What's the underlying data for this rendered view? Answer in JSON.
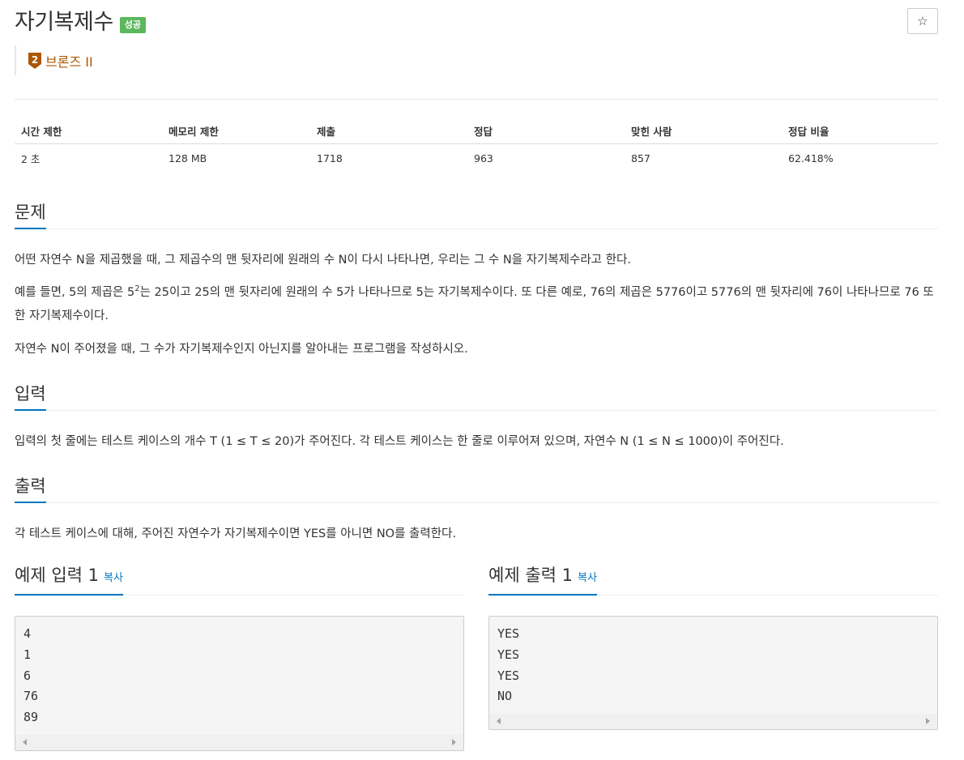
{
  "header": {
    "title": "자기복제수",
    "result_badge": "성공",
    "star_glyph": "☆",
    "tier_number": "2",
    "tier_label": "브론즈 II",
    "tier_color": "#ad5600"
  },
  "info": {
    "columns": [
      "시간 제한",
      "메모리 제한",
      "제출",
      "정답",
      "맞힌 사람",
      "정답 비율"
    ],
    "values": [
      "2 초",
      "128 MB",
      "1718",
      "963",
      "857",
      "62.418%"
    ]
  },
  "problem": {
    "heading": "문제",
    "p1": "어떤 자연수 N을 제곱했을 때, 그 제곱수의 맨 뒷자리에 원래의 수 N이 다시 나타나면, 우리는 그 수 N을 자기복제수라고 한다.",
    "p2_a": "예를 들면, 5의 제곱은 5",
    "p2_sup": "2",
    "p2_b": "는 25이고 25의 맨 뒷자리에 원래의 수 5가 나타나므로 5는 자기복제수이다. 또 다른 예로, 76의 제곱은 5776이고 5776의 맨 뒷자리에 76이 나타나므로 76 또한 자기복제수이다.",
    "p3": "자연수 N이 주어졌을 때, 그 수가 자기복제수인지 아닌지를 알아내는 프로그램을 작성하시오."
  },
  "input": {
    "heading": "입력",
    "text": "입력의 첫 줄에는 테스트 케이스의 개수 T (1 ≤ T ≤ 20)가 주어진다. 각 테스트 케이스는 한 줄로 이루어져 있으며, 자연수 N (1 ≤ N ≤ 1000)이 주어진다."
  },
  "output": {
    "heading": "출력",
    "text": "각 테스트 케이스에 대해, 주어진 자연수가 자기복제수이면 YES를 아니면 NO를 출력한다."
  },
  "samples": {
    "input_heading": "예제 입력 1",
    "output_heading": "예제 출력 1",
    "copy_label": "복사",
    "input_lines": [
      "4",
      "1",
      "6",
      "76",
      "89"
    ],
    "output_lines": [
      "YES",
      "YES",
      "YES",
      "NO"
    ]
  }
}
